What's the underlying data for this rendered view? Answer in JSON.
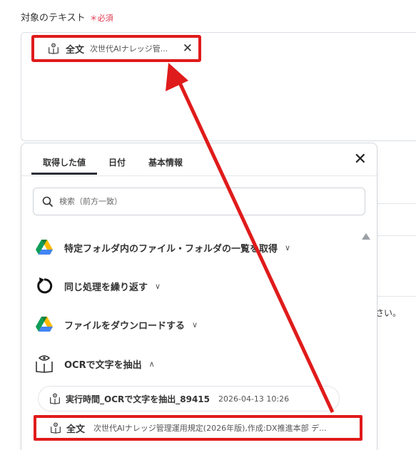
{
  "field": {
    "label": "対象のテキスト",
    "required_label": "＊必須"
  },
  "chip": {
    "key": "全文",
    "value": "次世代AIナレッジ管..."
  },
  "background": {
    "side_text": "さい。"
  },
  "panel": {
    "tabs": [
      {
        "label": "取得した値",
        "active": true
      },
      {
        "label": "日付",
        "active": false
      },
      {
        "label": "基本情報",
        "active": false
      }
    ],
    "search_placeholder": "検索（前方一致）",
    "items": [
      {
        "label": "特定フォルダ内のファイル・フォルダの一覧を取得",
        "icon": "google-drive-icon",
        "expanded": false
      },
      {
        "label": "同じ処理を繰り返す",
        "icon": "loop-icon",
        "expanded": false
      },
      {
        "label": "ファイルをダウンロードする",
        "icon": "google-drive-icon",
        "expanded": false
      },
      {
        "label": "OCRで文字を抽出",
        "icon": "ocr-book-icon",
        "expanded": true
      }
    ],
    "sub_row": {
      "key": "実行時間_OCRで文字を抽出_89415",
      "date": "2026-04-13 10:26"
    },
    "selected_row": {
      "key": "全文",
      "value": "次世代AIナレッジ管理運用規定(2026年版),作成:DX推進本部 デ..."
    }
  },
  "colors": {
    "highlight": "#e01b1b",
    "required": "#e0374e"
  }
}
